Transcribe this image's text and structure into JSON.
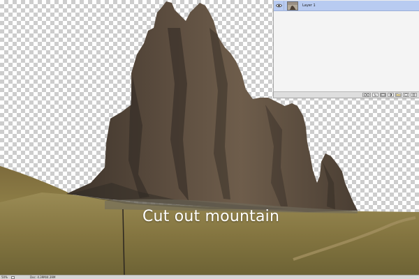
{
  "caption": "Cut out mountain",
  "layers_panel": {
    "layers": [
      {
        "name": "Layer 1",
        "visible": true,
        "selected": true
      }
    ],
    "footer_buttons": [
      {
        "label": "",
        "icon": "link-icon"
      },
      {
        "label": "fx",
        "icon": "fx-icon"
      },
      {
        "label": "",
        "icon": "mask-icon"
      },
      {
        "label": "",
        "icon": "adjustment-icon"
      },
      {
        "label": "",
        "icon": "group-folder-icon"
      },
      {
        "label": "",
        "icon": "new-layer-icon"
      },
      {
        "label": "",
        "icon": "trash-icon"
      }
    ]
  },
  "status_bar": {
    "zoom": "50%",
    "doc_info": "Doc: 4.39M/4.39M"
  },
  "colors": {
    "selection": "#b8cbf1",
    "checker": "#cdcdcd",
    "rock": "#5b4c3e",
    "ground": "#8a7a44"
  }
}
